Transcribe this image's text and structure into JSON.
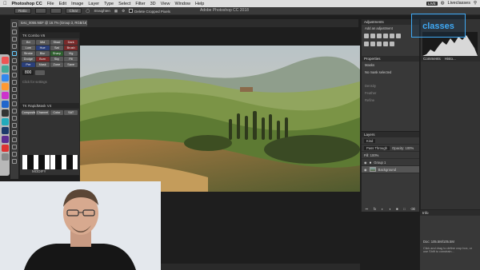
{
  "menubar": {
    "app_name": "Photoshop CC",
    "items": [
      "File",
      "Edit",
      "Image",
      "Layer",
      "Type",
      "Select",
      "Filter",
      "3D",
      "View",
      "Window",
      "Help"
    ],
    "right_text": "Liveclasses",
    "live_badge": "LIVE"
  },
  "options_bar": {
    "ratio": "Ratio",
    "clear": "Clear",
    "straighten": "Straighten",
    "delete_cropped": "Delete Cropped Pixels",
    "content_aware": "Content-Aware"
  },
  "app_title": "Adobe Photoshop CC 2018",
  "doc_tab": "tosc_0055.NEF @ 16.7% (Group 3, RGB/16) *",
  "left_panel": {
    "combo_title": "TK Combo V6",
    "buttons": [
      "Bri",
      "Mid",
      "Shad",
      "Dark",
      "Lum",
      "Hue",
      "Sat",
      "Brush",
      "Stroke",
      "Blur",
      "Sharp",
      "Vig",
      "Dodge",
      "Burn",
      "Sky",
      "Fill",
      "Pre",
      "Mask",
      "Zone",
      "Save"
    ],
    "number_value": "800",
    "hint_text": "Click for settings",
    "kuler_title": "TK RapidMask V4",
    "kuler_row1": [
      "Composite",
      "Channel",
      "Color",
      "SAT"
    ],
    "modify_label": "MODIFY"
  },
  "right_panels": {
    "adjustments_title": "Adjustments",
    "adjustments_sub": "Add an adjustment",
    "properties_title": "Properties",
    "properties_tab": "Masks",
    "no_mask": "No mask selected",
    "density_label": "Density",
    "feather_label": "Feather",
    "refine_label": "Refine",
    "layers_title": "Layers",
    "kind_label": "Kind",
    "blend_mode": "Pass Through",
    "opacity_label": "Opacity: 100%",
    "fill_label": "Fill: 100%",
    "layers": [
      {
        "name": "Group 1",
        "selected": false
      },
      {
        "name": "Background",
        "selected": true
      }
    ],
    "comments_tab": "Comments",
    "histo_tab": "Histo...",
    "info_tab": "Info",
    "doc_size": "Doc: 105.5M/105.5M",
    "info_hint": "Click and drag to define crop box, or use Shift to constrain..."
  },
  "watermark": "classes",
  "colors": {
    "accent": "#3fa9f5",
    "panel": "#383838",
    "menubar": "#dedede"
  }
}
